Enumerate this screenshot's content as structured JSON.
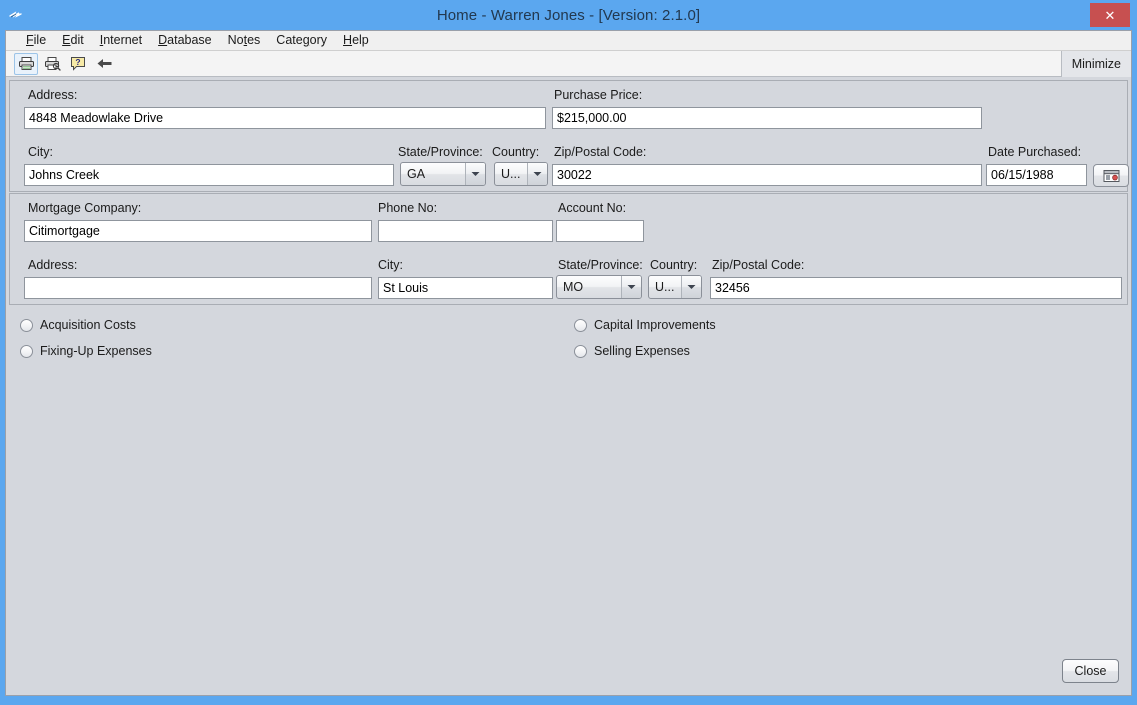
{
  "window": {
    "title": "Home - Warren Jones - [Version: 2.1.0]",
    "title_icon": "app-icon",
    "close_glyph": "✕",
    "accent_blue": "#5ba7ef",
    "close_red": "#c75050",
    "panel_bg": "#d4d7dd"
  },
  "menubar": {
    "items": [
      {
        "label": "File",
        "mnemonic_index": 0
      },
      {
        "label": "Edit",
        "mnemonic_index": 0
      },
      {
        "label": "Internet",
        "mnemonic_index": 0
      },
      {
        "label": "Database",
        "mnemonic_index": 0
      },
      {
        "label": "Notes",
        "mnemonic_index": 2
      },
      {
        "label": "Category",
        "mnemonic_index": 4
      },
      {
        "label": "Help",
        "mnemonic_index": 0
      }
    ]
  },
  "toolbar": {
    "buttons": [
      {
        "name": "print-icon",
        "focused": true
      },
      {
        "name": "print-preview-icon",
        "focused": false
      },
      {
        "name": "help-icon",
        "focused": false
      },
      {
        "name": "back-arrow-icon",
        "focused": false
      }
    ],
    "minimize_label": "Minimize"
  },
  "property_panel": {
    "address_label": "Address:",
    "address_value": "4848 Meadowlake Drive",
    "purchase_price_label": "Purchase Price:",
    "purchase_price_value": "$215,000.00",
    "city_label": "City:",
    "city_value": "Johns Creek",
    "state_label": "State/Province:",
    "state_value": "GA",
    "country_label": "Country:",
    "country_value": "U...",
    "zip_label": "Zip/Postal Code:",
    "zip_value": "30022",
    "date_purchased_label": "Date Purchased:",
    "date_purchased_value": "06/15/1988",
    "date_button_icon": "calendar-icon"
  },
  "mortgage_panel": {
    "company_label": "Mortgage Company:",
    "company_value": "Citimortgage",
    "phone_label": "Phone No:",
    "phone_value": "",
    "account_label": "Account No:",
    "account_value": "",
    "address_label": "Address:",
    "address_value": "",
    "city_label": "City:",
    "city_value": "St Louis",
    "state_label": "State/Province:",
    "state_value": "MO",
    "country_label": "Country:",
    "country_value": "U...",
    "zip_label": "Zip/Postal Code:",
    "zip_value": "32456"
  },
  "options": {
    "items": [
      {
        "label": "Acquisition Costs",
        "selected": false
      },
      {
        "label": "Fixing-Up Expenses",
        "selected": false
      },
      {
        "label": "Capital Improvements",
        "selected": false
      },
      {
        "label": "Selling Expenses",
        "selected": false
      }
    ]
  },
  "footer": {
    "close_label": "Close"
  }
}
